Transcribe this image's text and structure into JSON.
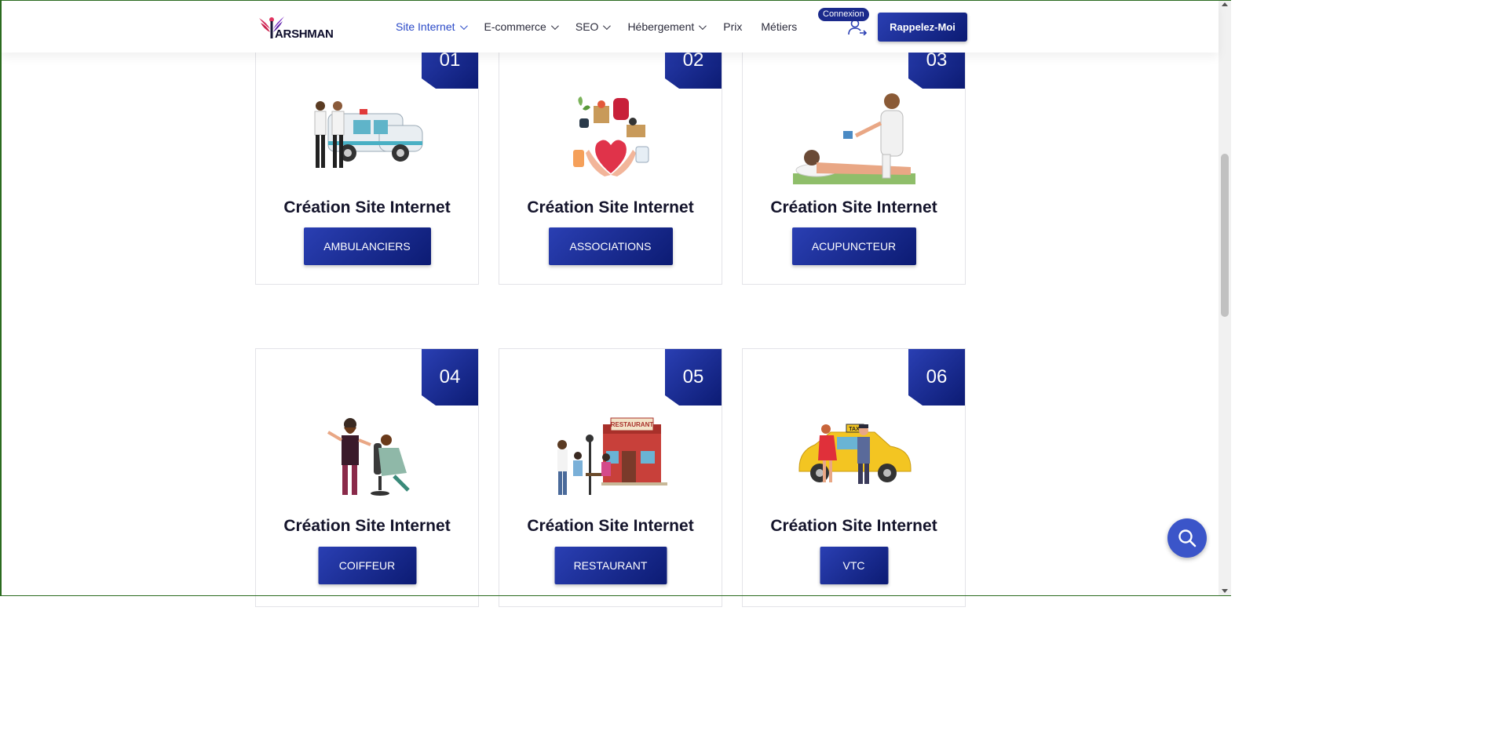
{
  "brand": {
    "logo_text": "ARSHMAN"
  },
  "nav": {
    "items": [
      {
        "label": "Site Internet",
        "dropdown": true,
        "active": true
      },
      {
        "label": "E-commerce",
        "dropdown": true
      },
      {
        "label": "SEO",
        "dropdown": true
      },
      {
        "label": "Hébergement",
        "dropdown": true
      },
      {
        "label": "Prix",
        "dropdown": false
      },
      {
        "label": "Métiers",
        "dropdown": false
      }
    ],
    "login_badge": "Connexion",
    "cta_label": "Rappelez-Moi"
  },
  "cards": [
    {
      "number": "01",
      "title": "Création Site Internet",
      "button": "AMBULANCIERS",
      "icon": "ambulance-illustration"
    },
    {
      "number": "02",
      "title": "Création Site Internet",
      "button": "ASSOCIATIONS",
      "icon": "charity-illustration"
    },
    {
      "number": "03",
      "title": "Création Site Internet",
      "button": "ACUPUNCTEUR",
      "icon": "acupuncture-illustration"
    },
    {
      "number": "04",
      "title": "Création Site Internet",
      "button": "COIFFEUR",
      "icon": "barber-illustration"
    },
    {
      "number": "05",
      "title": "Création Site Internet",
      "button": "RESTAURANT",
      "icon": "restaurant-illustration",
      "sign_text": "RESTAURANT"
    },
    {
      "number": "06",
      "title": "Création Site Internet",
      "button": "VTC",
      "icon": "taxi-illustration",
      "sign_text": "TAXI"
    }
  ],
  "colors": {
    "accent": "#1b2a8c",
    "nav_active": "#2a49c7",
    "fab": "#3b55c9"
  }
}
